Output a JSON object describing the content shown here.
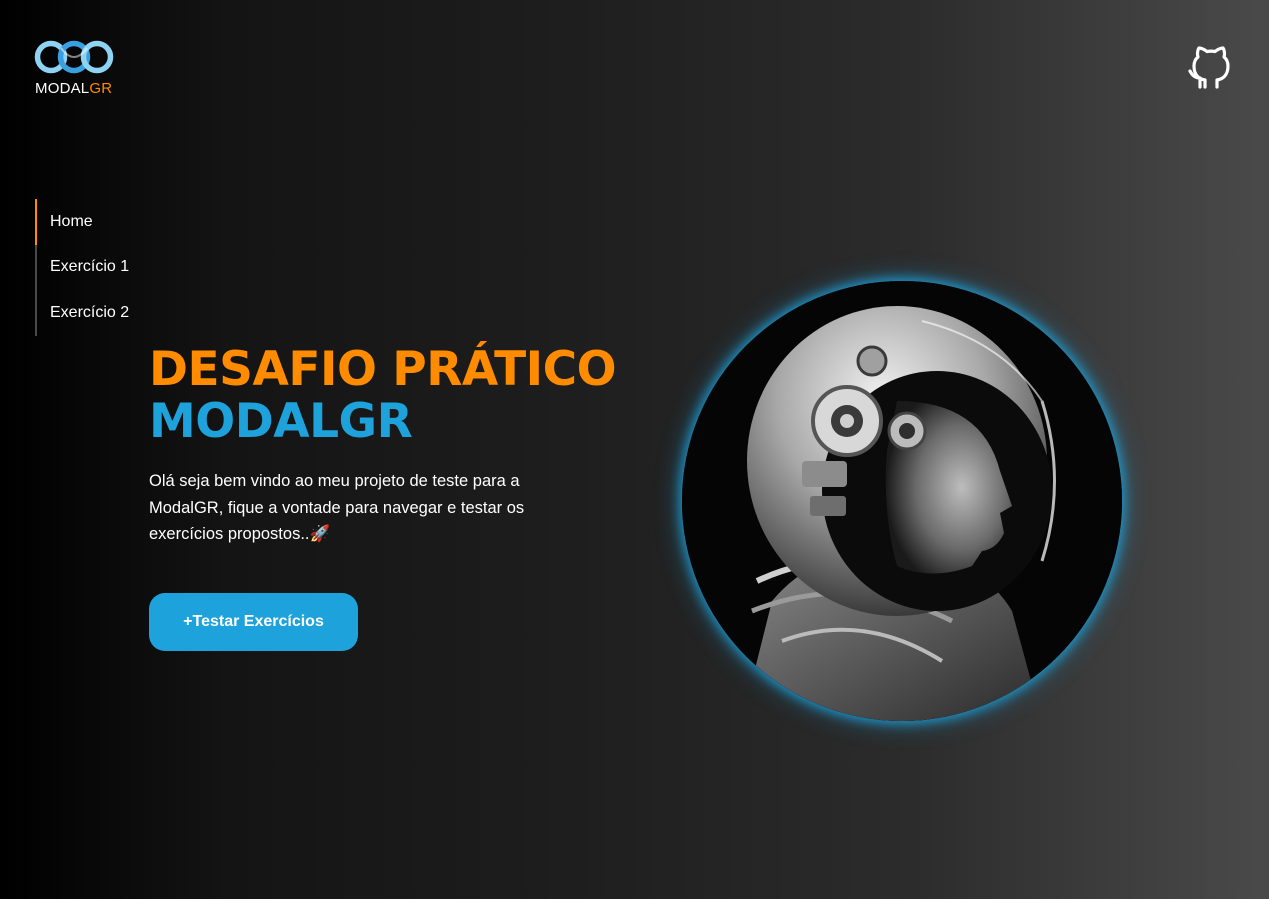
{
  "brand": {
    "logo_prefix": "MODAL",
    "logo_accent": "GR",
    "logo_icon": "infinity-logo-icon",
    "primary_color": "#1ea2dc",
    "accent_color": "#ff8c00"
  },
  "header": {
    "github_icon": "github-icon"
  },
  "nav": {
    "items": [
      {
        "label": "Home",
        "active": true
      },
      {
        "label": "Exercício 1",
        "active": false
      },
      {
        "label": "Exercício 2",
        "active": false
      }
    ]
  },
  "hero": {
    "title_line1": "DESAFIO PRÁTICO",
    "title_line2": "MODALGR",
    "description": "Olá seja bem vindo ao meu projeto de teste para a ModalGR, fique a vontade para navegar e testar os exercícios propostos..🚀",
    "cta_label": "+Testar Exercícios",
    "image_icon": "astronaut-portrait-image"
  }
}
